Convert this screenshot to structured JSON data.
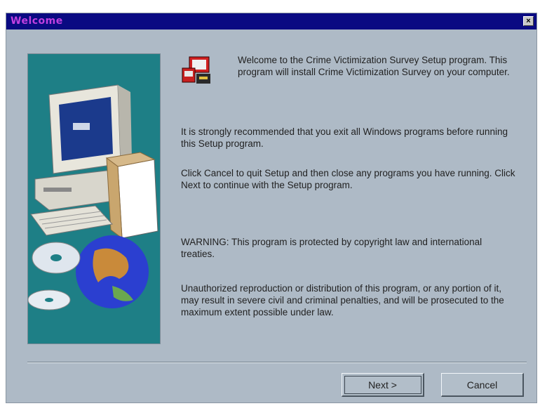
{
  "window": {
    "title": "Welcome",
    "close_glyph": "×"
  },
  "icons": [
    "close-icon",
    "computer-illustration",
    "globe-cd-illustration",
    "setup-app-icon"
  ],
  "content": {
    "intro": "Welcome to the Crime Victimization Survey Setup program.  This program will install Crime Victimization Survey on your computer.",
    "recommend": "It is strongly recommended that you exit all Windows programs before running this Setup program.",
    "instructions": "Click Cancel to quit Setup and then close any programs you have running.  Click Next to continue with the Setup program.",
    "warning": "WARNING:  This program is protected by copyright law and international treaties.",
    "legal": "Unauthorized reproduction or distribution of this program, or any portion of it, may result in severe civil and criminal penalties, and will be prosecuted to the maximum extent possible under law."
  },
  "buttons": {
    "next": "Next >",
    "cancel": "Cancel"
  },
  "colors": {
    "titlebar": "#0a0a82",
    "title_text": "#c040e0",
    "dialog_bg": "#aebac6",
    "banner": "#1e7f86"
  }
}
